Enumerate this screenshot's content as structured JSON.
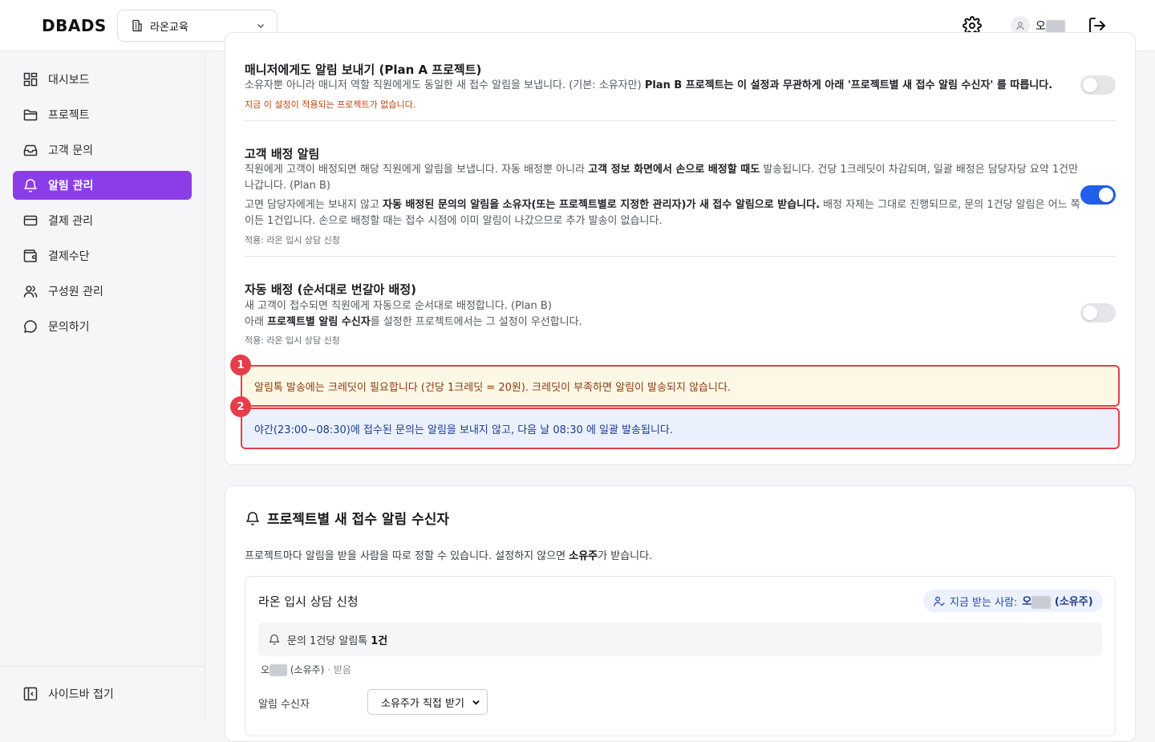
{
  "header": {
    "logo": "DBADS",
    "org_name": "라온교육",
    "user_name": "오"
  },
  "sidebar": {
    "items": [
      {
        "label": "대시보드",
        "icon": "dashboard-icon"
      },
      {
        "label": "프로젝트",
        "icon": "folder-icon"
      },
      {
        "label": "고객 문의",
        "icon": "inbox-icon"
      },
      {
        "label": "알림 관리",
        "icon": "bell-icon",
        "active": true
      },
      {
        "label": "결제 관리",
        "icon": "credit-card-icon"
      },
      {
        "label": "결제수단",
        "icon": "wallet-icon"
      },
      {
        "label": "구성원 관리",
        "icon": "users-icon"
      },
      {
        "label": "문의하기",
        "icon": "chat-icon"
      }
    ],
    "collapse_label": "사이드바 접기"
  },
  "settings": {
    "manager_alert": {
      "title": "매니저에게도 알림 보내기 (Plan A 프로젝트)",
      "desc_plain": "소유자뿐 아니라 매니저 역할 직원에게도 동일한 새 접수 알림을 보냅니다. (기본: 소유자만) ",
      "desc_bold": "Plan B 프로젝트는 이 설정과 무관하게 아래 '프로젝트별 새 접수 알림 수신자' 를 따릅니다.",
      "warning": "지금 이 설정이 적용되는 프로젝트가 없습니다.",
      "enabled": false
    },
    "assign_alert": {
      "title": "고객 배정 알림",
      "desc1_a": "직원에게 고객이 배정되면 해당 직원에게 알림을 보냅니다. 자동 배정뿐 아니라 ",
      "desc1_bold": "고객 정보 화면에서 손으로 배정할 때도",
      "desc1_b": " 발송됩니다. 건당 1크레딧이 차감되며, 일괄 배정은 담당자당 요약 1건만 나갑니다. (Plan B)",
      "desc2_a": "고면 담당자에게는 보내지 않고 ",
      "desc2_bold": "자동 배정된 문의의 알림을 소유자(또는 프로젝트별로 지정한 관리자)가 새 접수 알림으로 받습니다.",
      "desc2_b": " 배정 자체는 그대로 진행되므로, 문의 1건당 알림은 어느 쪽이든 1건입니다. 손으로 배정할 때는 접수 시점에 이미 알림이 나갔으므로 추가 발송이 없습니다.",
      "applied": "적용: 라온 입시 상담 신청",
      "enabled": true
    },
    "auto_assign": {
      "title": "자동 배정 (순서대로 번갈아 배정)",
      "desc1": "새 고객이 접수되면 직원에게 자동으로 순서대로 배정합니다. (Plan B)",
      "desc2_a": "아래 ",
      "desc2_bold": "프로젝트별 알림 수신자",
      "desc2_b": "를 설정한 프로젝트에서는 그 설정이 우선합니다.",
      "applied": "적용: 라온 입시 상담 신청",
      "enabled": false
    },
    "notice_credit": "알림톡 발송에는 크레딧이 필요합니다 (건당 1크레딧 = 20원). 크레딧이 부족하면 알림이 발송되지 않습니다.",
    "notice_night": "야간(23:00~08:30)에 접수된 문의는 알림을 보내지 않고, 다음 날 08:30 에 일괄 발송됩니다.",
    "badges": [
      "1",
      "2"
    ]
  },
  "recipients": {
    "title": "프로젝트별 새 접수 알림 수신자",
    "desc_a": "프로젝트마다 알림을 받을 사람을 따로 정할 수 있습니다. 설정하지 않으면 ",
    "desc_bold": "소유주",
    "desc_b": "가 받습니다.",
    "project": {
      "name": "라온 입시 상담 신청",
      "current_label": "지금 받는 사람:",
      "current_name": "오",
      "current_role": "(소유주)",
      "count_label": "문의 1건당 알림톡",
      "count_value": "1건",
      "member_name": "오",
      "member_role": "(소유주)",
      "member_status": "· 받음",
      "recipient_label": "알림 수신자",
      "recipient_value": "소유주가 직접 받기"
    }
  },
  "colors": {
    "accent": "#8b3ee8",
    "toggle_on": "#2160e8",
    "highlight": "#e53e4a"
  }
}
